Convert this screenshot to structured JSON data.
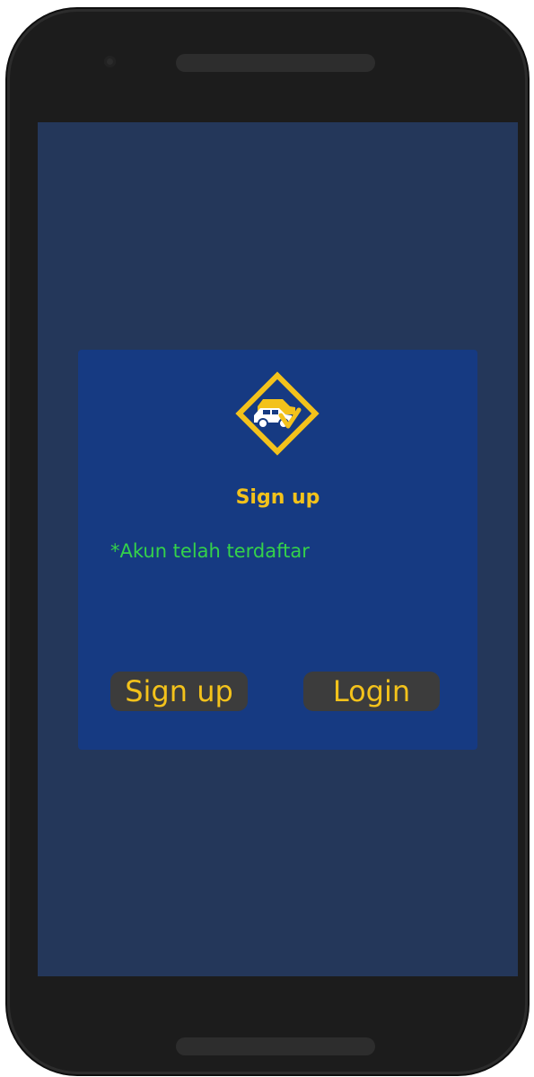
{
  "header": {
    "title": "Sign up"
  },
  "status": {
    "message": "*Akun telah terdaftar"
  },
  "buttons": {
    "signup_label": "Sign up",
    "login_label": "Login"
  },
  "logo": {
    "icon": "car-diamond-logo"
  },
  "colors": {
    "screen_bg": "#24375a",
    "card_bg": "#163a82",
    "accent": "#f3c21b",
    "status": "#34d24a",
    "button_bg": "#3c3c3c"
  }
}
